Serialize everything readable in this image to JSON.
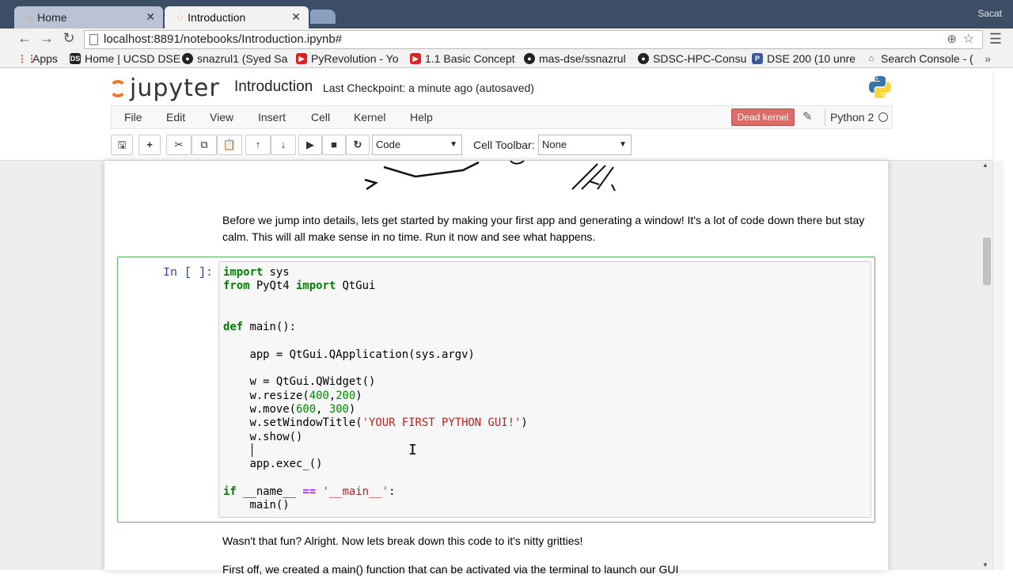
{
  "browser": {
    "tabs": [
      {
        "label": "Home"
      },
      {
        "label": "Introduction"
      }
    ],
    "user": "Sacat",
    "url": "localhost:8891/notebooks/Introduction.ipynb#",
    "bookmarks": [
      {
        "label": "Apps",
        "icon": "apps-grid-icon"
      },
      {
        "label": "Home | UCSD DSE",
        "icon": "ds-icon"
      },
      {
        "label": "snazrul1 (Syed Sa",
        "icon": "github-icon"
      },
      {
        "label": "PyRevolution - Yo",
        "icon": "youtube-icon"
      },
      {
        "label": "1.1 Basic Concept",
        "icon": "youtube-icon"
      },
      {
        "label": "mas-dse/ssnazrul",
        "icon": "github-icon"
      },
      {
        "label": "SDSC-HPC-Consu",
        "icon": "github-icon"
      },
      {
        "label": "DSE 200 (10 unre",
        "icon": "p-icon"
      },
      {
        "label": "Search Console - (",
        "icon": "search-console-icon"
      }
    ]
  },
  "notebook": {
    "logo_text": "jupyter",
    "name": "Introduction",
    "checkpoint": "Last Checkpoint: a minute ago (autosaved)",
    "menu": [
      "File",
      "Edit",
      "View",
      "Insert",
      "Cell",
      "Kernel",
      "Help"
    ],
    "kernel_status": "Dead kernel",
    "kernel_name": "Python 2",
    "cell_type": "Code",
    "cell_toolbar_label": "Cell Toolbar:",
    "cell_toolbar_value": "None"
  },
  "content": {
    "intro_text": "Before we jump into details, lets get started by making your first app and generating a window! It's a lot of code down there but stay calm. This will all make sense in no time. Run it now and see what happens.",
    "prompt": "In [ ]:",
    "after_text": "Wasn't that fun? Alright. Now lets break down this code to it's nitty gritties!",
    "partial_text": "First off, we created a main() function that can be activated via the terminal to launch our GUI"
  },
  "colors": {
    "accent_orange": "#f37726",
    "dead_kernel": "#d9534f",
    "cell_border": "#5cb85c"
  }
}
